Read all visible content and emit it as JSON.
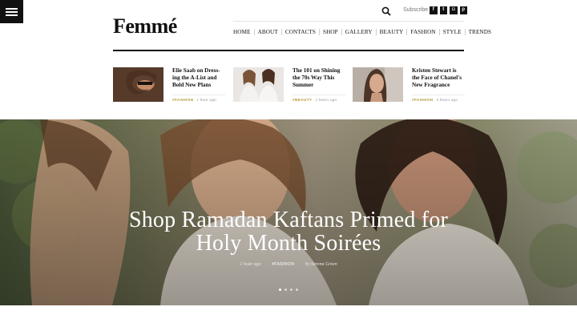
{
  "site": {
    "logo": "Femmé"
  },
  "utility": {
    "subscribe_label": "Subscribe",
    "social": [
      {
        "icon": "facebook-icon",
        "glyph": "f"
      },
      {
        "icon": "twitter-icon",
        "glyph": "t"
      },
      {
        "icon": "instagram-icon",
        "glyph": "◘"
      },
      {
        "icon": "pinterest-icon",
        "glyph": "p"
      }
    ]
  },
  "nav": {
    "items": [
      "HOME",
      "ABOUT",
      "CONTACTS",
      "SHOP",
      "GALLERY",
      "BEAUTY",
      "FASHION",
      "STYLE",
      "TRENDS"
    ]
  },
  "featured": [
    {
      "title": "Elie Saab on Dress-ing the A-List and Bold New Plans",
      "category": "#FASHION",
      "time": "1 hour ago"
    },
    {
      "title": "The 101 on Shining the 70s Way This Summer",
      "category": "#BEAUTY",
      "time": "2 hours ago"
    },
    {
      "title": "Kristen Stewart is the Face of Chanel's New Fragrance",
      "category": "#FASHION",
      "time": "4 hours ago"
    }
  ],
  "hero": {
    "title_line1": "Shop Ramadan Kaftans Primed for",
    "title_line2": "Holy Month Soirées",
    "time": "1 hour ago",
    "category": "#FASHION",
    "author": "by Serena Green",
    "slides": 4,
    "active_slide": 1
  },
  "colors": {
    "accent": "#b49a3a",
    "dark": "#111111"
  }
}
